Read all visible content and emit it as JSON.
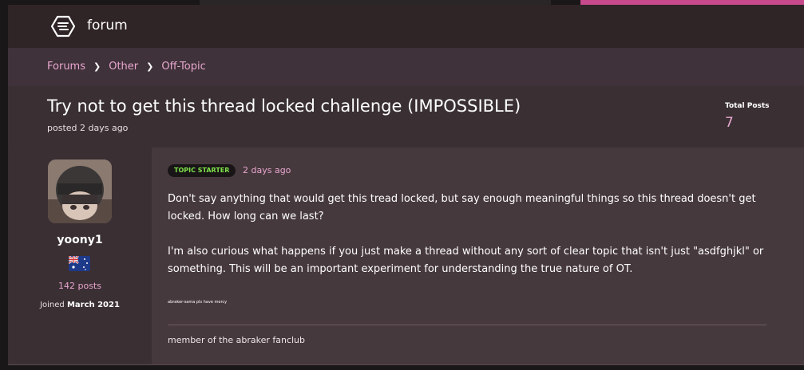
{
  "nav": {
    "brand": "forum",
    "logo_icon": "forum-logo-icon"
  },
  "breadcrumb": [
    "Forums",
    "Other",
    "Off-Topic"
  ],
  "thread": {
    "title": "Try not to get this thread locked challenge (IMPOSSIBLE)",
    "posted": "posted 2 days ago",
    "total_posts_label": "Total Posts",
    "total_posts_value": "7"
  },
  "post": {
    "author": {
      "username": "yoony1",
      "flag": "australia-flag-icon",
      "post_count": "142 posts",
      "joined_label": "Joined",
      "joined_date": "March 2021"
    },
    "badge": "TOPIC STARTER",
    "date": "2 days ago",
    "paragraphs": [
      "Don't say anything that would get this tread locked, but say enough meaningful things so this thread doesn't get locked. How long can we last?",
      "I'm also curious what happens if you just make a thread without any sort of clear topic that isn't just \"asdfghjkl\" or something. This will be an important experiment for understanding the true nature of OT."
    ],
    "small_text": "abraker-sama pls have mercy",
    "signature": "member of the abraker fanclub"
  },
  "colors": {
    "accent": "#e7a6cf",
    "badge_text": "#7ee24a",
    "nav_bg": "#2f2426"
  }
}
